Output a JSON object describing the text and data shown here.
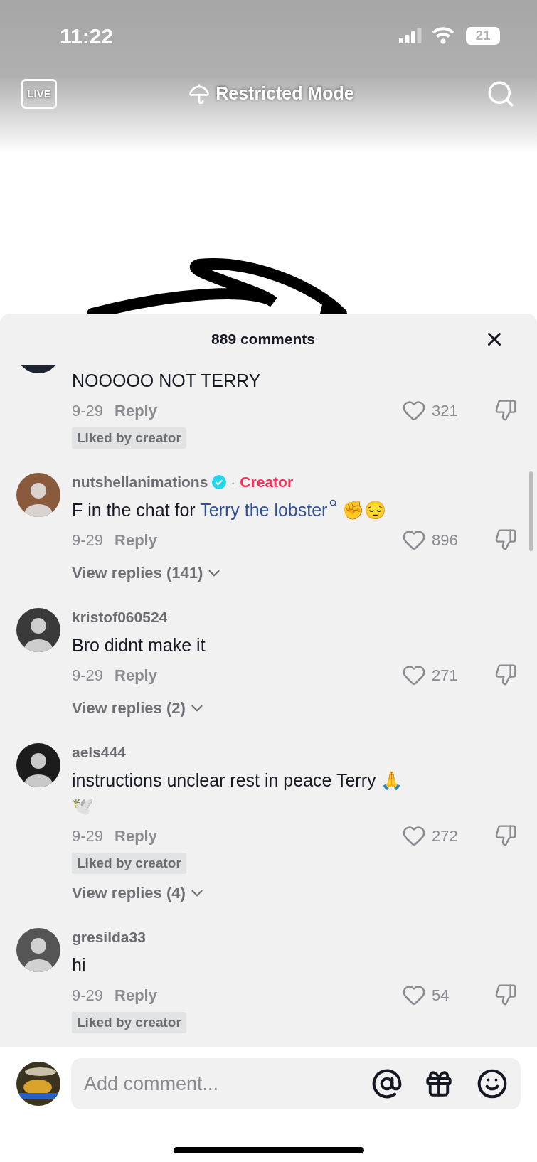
{
  "status_bar": {
    "time": "11:22",
    "battery": "21"
  },
  "top_bar": {
    "live_label": "LIVE",
    "title": "Restricted Mode"
  },
  "comments_sheet": {
    "title": "889 comments",
    "comments": [
      {
        "kind": "partial",
        "body": [
          {
            "kind": "plain",
            "text": "NOOOOO NOT TERRY"
          }
        ],
        "date": "9-29",
        "reply": "Reply",
        "likes": "321",
        "liked_by_creator": "Liked by creator"
      },
      {
        "kind": "full",
        "name": "nutshellanimations",
        "verified": true,
        "role_separator": "·",
        "role": "Creator",
        "body": [
          {
            "kind": "plain",
            "text": "F in the chat for "
          },
          {
            "kind": "search_link",
            "text": "Terry the lobster"
          },
          {
            "kind": "plain",
            "text": " ✊😔"
          }
        ],
        "date": "9-29",
        "reply": "Reply",
        "likes": "896",
        "view_replies": "View replies (141)"
      },
      {
        "kind": "full",
        "name": "kristof060524",
        "verified": false,
        "body": [
          {
            "kind": "plain",
            "text": "Bro didnt make it"
          }
        ],
        "date": "9-29",
        "reply": "Reply",
        "likes": "271",
        "view_replies": "View replies (2)"
      },
      {
        "kind": "full",
        "name": "aels444",
        "verified": false,
        "body": [
          {
            "kind": "plain",
            "text": "instructions unclear rest in peace Terry 🙏 🕊️"
          }
        ],
        "date": "9-29",
        "reply": "Reply",
        "likes": "272",
        "liked_by_creator": "Liked by creator",
        "view_replies": "View replies (4)"
      },
      {
        "kind": "full",
        "name": "gresilda33",
        "verified": false,
        "body": [
          {
            "kind": "plain",
            "text": "hi"
          }
        ],
        "date": "9-29",
        "reply": "Reply",
        "likes": "54",
        "liked_by_creator": "Liked by creator"
      }
    ]
  },
  "comment_bar": {
    "placeholder": "Add comment..."
  }
}
